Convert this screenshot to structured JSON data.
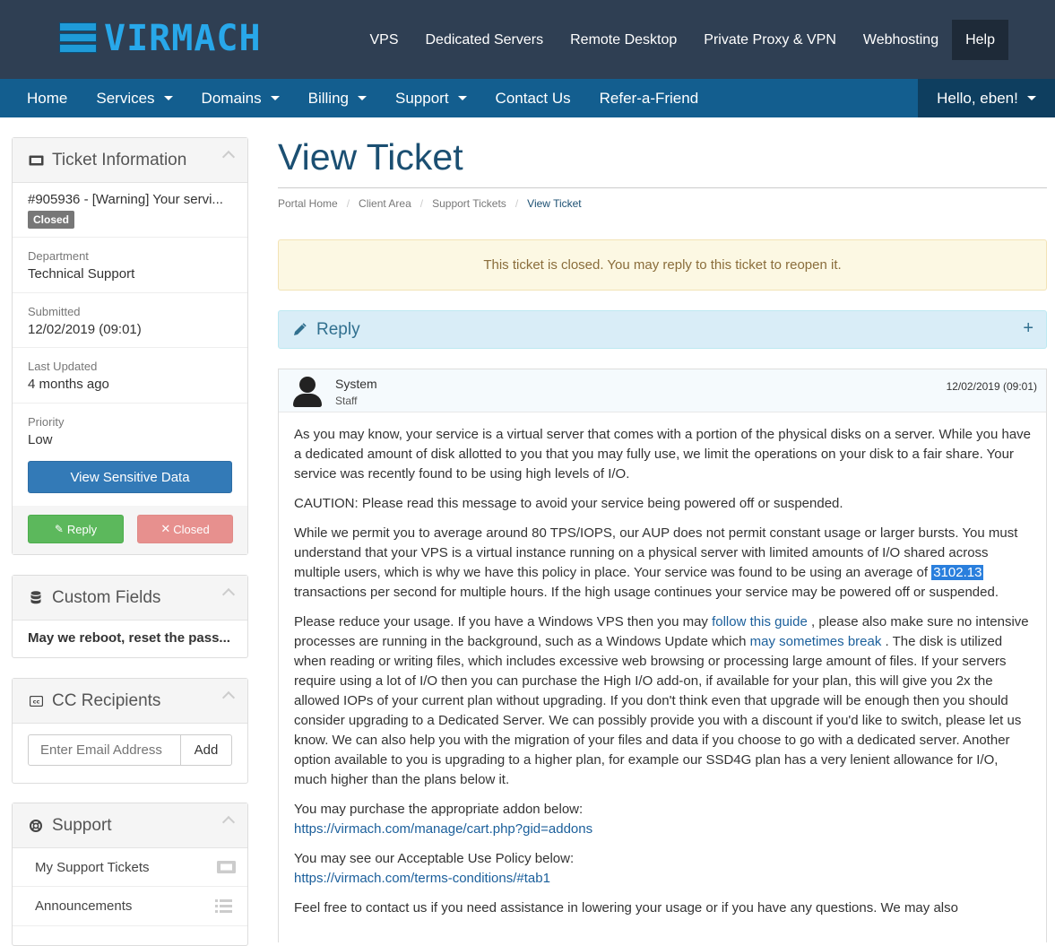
{
  "brand": {
    "name": "VIRMACH"
  },
  "topnav": {
    "items": [
      "VPS",
      "Dedicated Servers",
      "Remote Desktop",
      "Private Proxy & VPN",
      "Webhosting",
      "Help"
    ]
  },
  "mainnav": {
    "items": [
      "Home",
      "Services",
      "Domains",
      "Billing",
      "Support",
      "Contact Us",
      "Refer-a-Friend"
    ],
    "user": "Hello, eben!"
  },
  "sidebar": {
    "ticket_info": {
      "title": "Ticket Information",
      "subject": "#905936 - [Warning] Your servi...",
      "status": "Closed",
      "department_label": "Department",
      "department": "Technical Support",
      "submitted_label": "Submitted",
      "submitted": "12/02/2019 (09:01)",
      "updated_label": "Last Updated",
      "updated": "4 months ago",
      "priority_label": "Priority",
      "priority": "Low",
      "sensitive_button": "View Sensitive Data",
      "reply_button": "Reply",
      "closed_button": "Closed"
    },
    "custom_fields": {
      "title": "Custom Fields",
      "field": "May we reboot, reset the pass..."
    },
    "cc": {
      "title": "CC Recipients",
      "placeholder": "Enter Email Address",
      "add_button": "Add"
    },
    "support": {
      "title": "Support",
      "items": [
        "My Support Tickets",
        "Announcements"
      ]
    }
  },
  "main": {
    "title": "View Ticket",
    "breadcrumb": [
      "Portal Home",
      "Client Area",
      "Support Tickets",
      "View Ticket"
    ],
    "alert": "This ticket is closed. You may reply to this ticket to reopen it.",
    "reply_label": "Reply",
    "message": {
      "author": "System",
      "role": "Staff",
      "date": "12/02/2019 (09:01)",
      "p1": "As you may know, your service is a virtual server that comes with a portion of the physical disks on a server. While you have a dedicated amount of disk allotted to you that you may fully use, we limit the operations on your disk to a fair share. Your service was recently found to be using high levels of I/O.",
      "p2": "CAUTION: Please read this message to avoid your service being powered off or suspended.",
      "p3_a": "While we permit you to average around 80 TPS/IOPS, our AUP does not permit constant usage or larger bursts. You must understand that your VPS is a virtual instance running on a physical server with limited amounts of I/O shared across multiple users, which is why we have this policy in place. Your service was found to be using an average of ",
      "p3_highlight": "3102.13",
      "p3_b": " transactions per second for multiple hours. If the high usage continues your service may be powered off or suspended.",
      "p4_a": "Please reduce your usage. If you have a Windows VPS then you may ",
      "p4_link1": "follow this guide",
      "p4_b": " , please also make sure no intensive processes are running in the background, such as a Windows Update which ",
      "p4_link2": "may sometimes break",
      "p4_c": " . The disk is utilized when reading or writing files, which includes excessive web browsing or processing large amount of files. If your servers require using a lot of I/O then you can purchase the High I/O add-on, if available for your plan, this will give you 2x the allowed IOPs of your current plan without upgrading. If you don't think even that upgrade will be enough then you should consider upgrading to a Dedicated Server. We can possibly provide you with a discount if you'd like to switch, please let us know. We can also help you with the migration of your files and data if you choose to go with a dedicated server. Another option available to you is upgrading to a higher plan, for example our SSD4G plan has a very lenient allowance for I/O, much higher than the plans below it.",
      "p5": "You may purchase the appropriate addon below:",
      "p5_link": "https://virmach.com/manage/cart.php?gid=addons",
      "p6": "You may see our Acceptable Use Policy below:",
      "p6_link": "https://virmach.com/terms-conditions/#tab1",
      "p7": "Feel free to contact us if you need assistance in lowering your usage or if you have any questions. We may also"
    }
  },
  "colors": {
    "topbar": "#2f3f53",
    "mainnav": "#135e8f",
    "title": "#1b4f72",
    "btn_primary": "#337ab7",
    "btn_success": "#5cb85c",
    "btn_danger": "#d9534f"
  }
}
